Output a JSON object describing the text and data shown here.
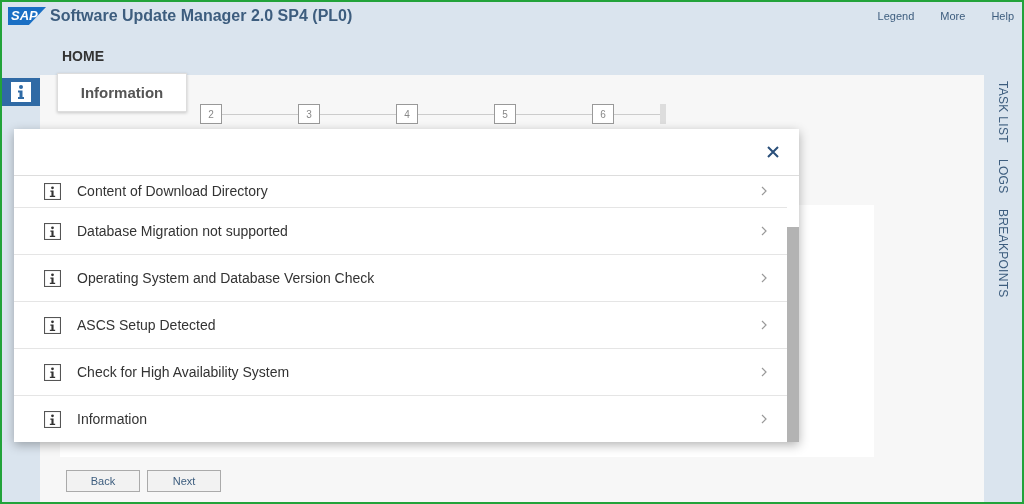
{
  "app": {
    "logo": "SAP",
    "title": "Software Update Manager 2.0 SP4 (PL0)",
    "header_links": [
      "Legend",
      "More",
      "Help"
    ],
    "breadcrumb": "HOME"
  },
  "popover_tab": {
    "label": "Information"
  },
  "steps": [
    "2",
    "3",
    "4",
    "5",
    "6"
  ],
  "side_tabs": [
    "TASK LIST",
    "LOGS",
    "BREAKPOINTS"
  ],
  "dialog": {
    "items": [
      {
        "label": "Content of Download Directory"
      },
      {
        "label": "Database Migration not supported"
      },
      {
        "label": "Operating System and Database Version Check"
      },
      {
        "label": "ASCS Setup Detected"
      },
      {
        "label": "Check for High Availability System"
      },
      {
        "label": "Information"
      }
    ]
  },
  "buttons": [
    "Back",
    "Next"
  ]
}
